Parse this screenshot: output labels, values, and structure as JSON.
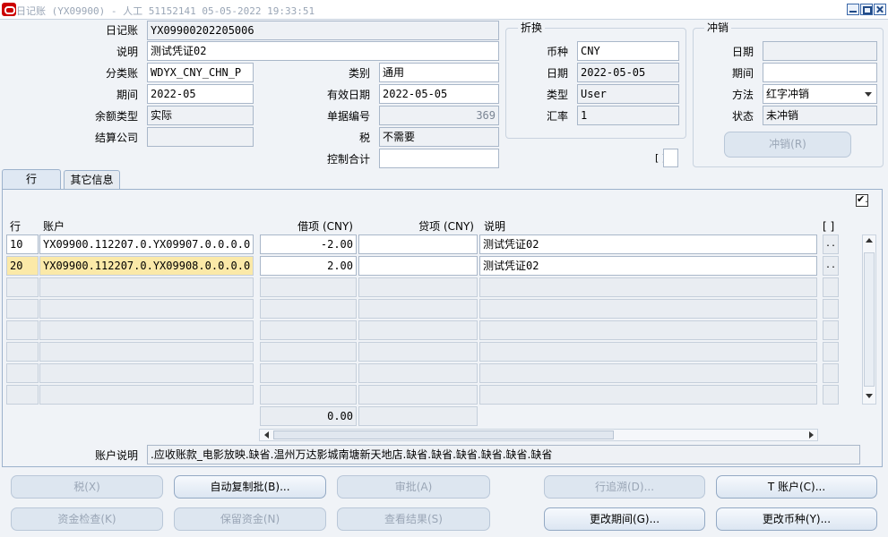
{
  "title": "日记账 (YX09900) - 人工 51152141 05-05-2022 19:33:51",
  "header": {
    "journal": {
      "label": "日记账",
      "value": "YX09900202205006"
    },
    "description": {
      "label": "说明",
      "value": "测试凭证02"
    },
    "ledger": {
      "label": "分类账",
      "value": "WDYX_CNY_CHN_P"
    },
    "category": {
      "label": "类别",
      "value": "通用"
    },
    "period": {
      "label": "期间",
      "value": "2022-05"
    },
    "effective_date": {
      "label": "有效日期",
      "value": "2022-05-05"
    },
    "balance_type": {
      "label": "余额类型",
      "value": "实际"
    },
    "doc_number": {
      "label": "单据编号",
      "value": "369"
    },
    "clearing_company": {
      "label": "结算公司",
      "value": ""
    },
    "tax": {
      "label": "税",
      "value": "不需要"
    },
    "control_total": {
      "label": "控制合计",
      "value": ""
    }
  },
  "conversion": {
    "title": "折换",
    "currency": {
      "label": "币种",
      "value": "CNY"
    },
    "date": {
      "label": "日期",
      "value": "2022-05-05"
    },
    "type": {
      "label": "类型",
      "value": "User"
    },
    "rate": {
      "label": "汇率",
      "value": "1"
    }
  },
  "reversal": {
    "title": "冲销",
    "date": {
      "label": "日期",
      "value": ""
    },
    "period": {
      "label": "期间",
      "value": ""
    },
    "method": {
      "label": "方法",
      "value": "红字冲销"
    },
    "status": {
      "label": "状态",
      "value": "未冲销"
    },
    "button": "冲销(R)"
  },
  "bracket_small": "[ ]",
  "tabs": [
    "行",
    "其它信息"
  ],
  "checkbox_mark": "✔.",
  "table": {
    "columns": {
      "line": "行",
      "account": "账户",
      "debit": "借项 (CNY)",
      "credit": "贷项 (CNY)",
      "desc": "说明",
      "extra": "[ ]"
    },
    "rows": [
      {
        "line": "10",
        "account": "YX09900.112207.0.YX09907.0.0.0.0.0",
        "debit": "-2.00",
        "credit": "",
        "desc": "测试凭证02",
        "more": ".."
      },
      {
        "line": "20",
        "account": "YX09900.112207.0.YX09908.0.0.0.0.0",
        "debit": "2.00",
        "credit": "",
        "desc": "测试凭证02",
        "more": ".."
      }
    ],
    "debit_total": "0.00",
    "credit_total": ""
  },
  "account_desc": {
    "label": "账户说明",
    "value": ".应收账款_电影放映.缺省.温州万达影城南塘新天地店.缺省.缺省.缺省.缺省.缺省.缺省"
  },
  "buttons": {
    "tax": "税(X)",
    "auto_copy": "自动复制批(B)...",
    "approve": "审批(A)",
    "line_drill": "行追溯(D)...",
    "t_account": "T 账户(C)...",
    "funds_check": "资金检查(K)",
    "reserve_funds": "保留资金(N)",
    "view_results": "查看结果(S)",
    "change_period": "更改期间(G)...",
    "change_currency": "更改币种(Y)..."
  }
}
